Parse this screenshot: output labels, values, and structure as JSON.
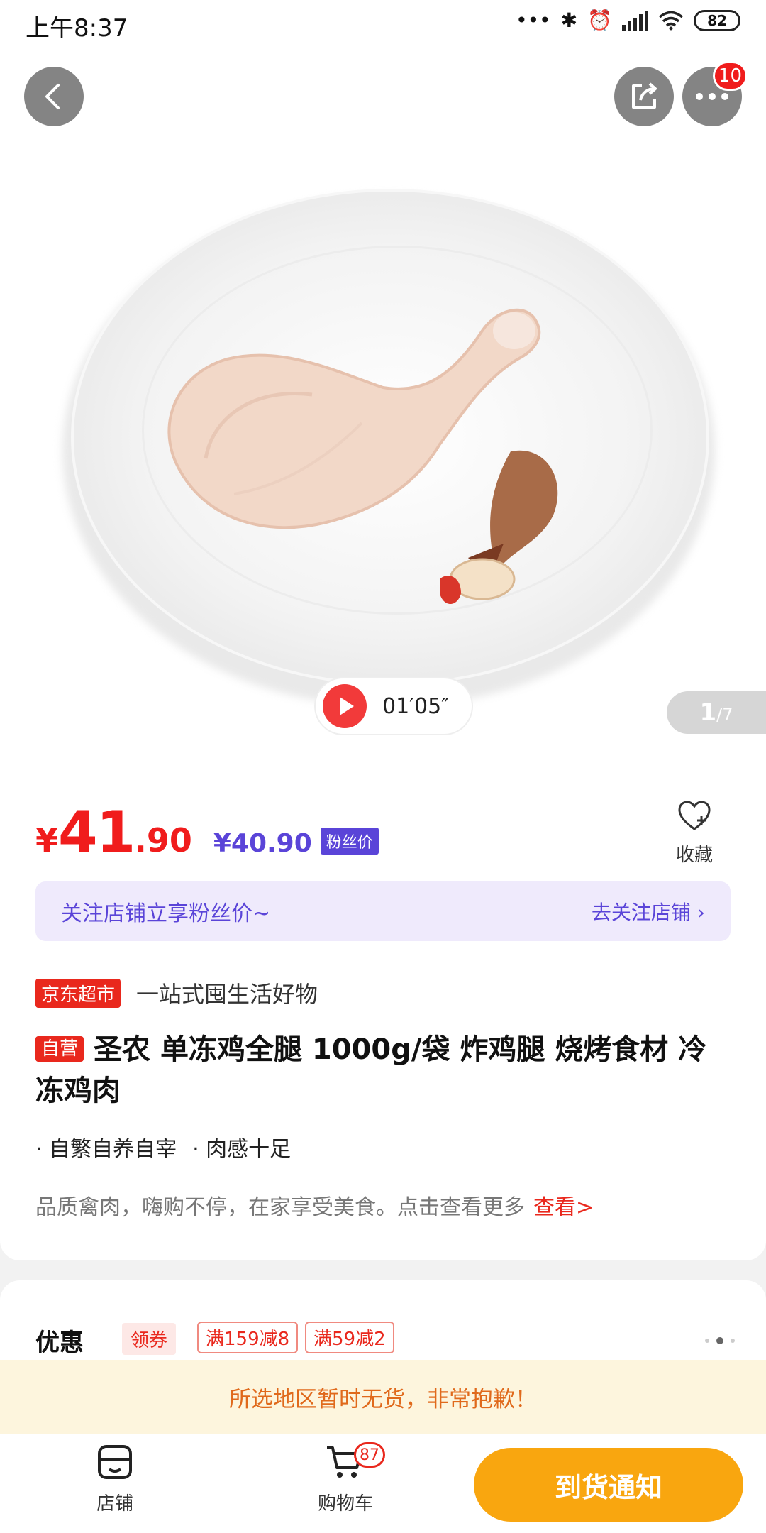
{
  "status_bar": {
    "time": "上午8:37",
    "dots": "•••",
    "bluetooth": "✱",
    "alarm": "⏰",
    "battery": "82"
  },
  "header": {
    "more_badge": "10"
  },
  "gallery": {
    "video_time": "01′05″",
    "current_page": "1",
    "total_pages": "/7"
  },
  "price": {
    "currency": "¥",
    "integer": "41",
    "decimal": ".90",
    "fan_price": "¥40.90",
    "fan_badge": "粉丝价",
    "favorite_label": "收藏"
  },
  "follow_banner": {
    "text": "关注店铺立享粉丝价~",
    "link": "去关注店铺 ›"
  },
  "store": {
    "badge": "京东超市",
    "slogan": "一站式囤生活好物"
  },
  "product": {
    "self_badge": "自营",
    "title": "圣农 单冻鸡全腿 1000g/袋 炸鸡腿 烧烤食材 冷冻鸡肉",
    "features": [
      "· 自繁自养自宰",
      "· 肉感十足"
    ],
    "description": "品质禽肉，嗨购不停，在家享受美食。点击查看更多",
    "description_link": "查看>"
  },
  "coupon": {
    "title": "优惠",
    "get_label": "领券",
    "tags": [
      "满159减8",
      "满59减2"
    ]
  },
  "notice": "所选地区暂时无货，非常抱歉！",
  "bottom_bar": {
    "store_label": "店铺",
    "cart_label": "购物车",
    "cart_badge": "87",
    "notify_label": "到货通知"
  },
  "colors": {
    "price_red": "#f01c1c",
    "fan_purple": "#5a44d8",
    "notify_orange": "#f9a60f",
    "notice_bg": "#fdf5dd"
  }
}
